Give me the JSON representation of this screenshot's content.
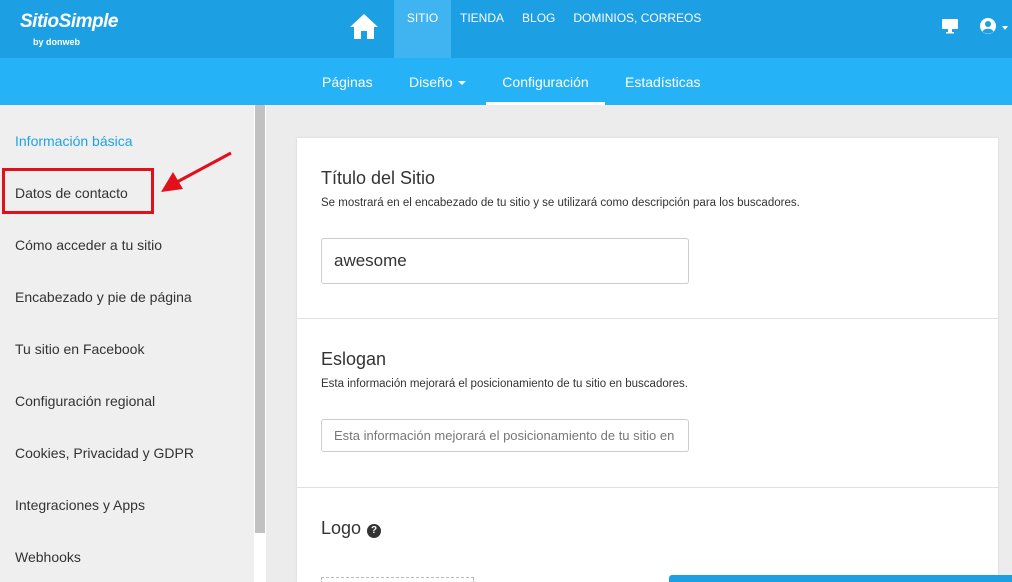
{
  "topbar": {
    "logo_text": "SitioSimple",
    "logo_sub": "by donweb",
    "nav": [
      {
        "label": "SITIO",
        "active": true
      },
      {
        "label": "TIENDA"
      },
      {
        "label": "BLOG"
      },
      {
        "label": "DOMINIOS, CORREOS"
      }
    ]
  },
  "subnav": {
    "tabs": [
      {
        "label": "Páginas"
      },
      {
        "label": "Diseño"
      },
      {
        "label": "Configuración",
        "active": true
      },
      {
        "label": "Estadísticas"
      }
    ]
  },
  "sidebar": {
    "items": [
      {
        "label": "Información básica",
        "active": true
      },
      {
        "label": "Datos de contacto",
        "highlighted": true
      },
      {
        "label": "Cómo acceder a tu sitio"
      },
      {
        "label": "Encabezado y pie de página"
      },
      {
        "label": "Tu sitio en Facebook"
      },
      {
        "label": "Configuración regional"
      },
      {
        "label": "Cookies, Privacidad y GDPR"
      },
      {
        "label": "Integraciones y Apps"
      },
      {
        "label": "Webhooks"
      }
    ]
  },
  "main": {
    "title_section": {
      "title": "Título del Sitio",
      "description": "Se mostrará en el encabezado de tu sitio y se utilizará como descripción para los buscadores.",
      "value": "awesome"
    },
    "slogan_section": {
      "title": "Eslogan",
      "description": "Esta información mejorará el posicionamiento de tu sitio en buscadores.",
      "placeholder": "Esta información mejorará el posicionamiento de tu sitio en buscadores."
    },
    "logo_section": {
      "title": "Logo",
      "help_glyph": "?"
    }
  },
  "colors": {
    "topbar": "#1c9fe3",
    "subbar": "#26b2f6",
    "active_link": "#1ea3e6",
    "highlight": "#e1101a"
  }
}
